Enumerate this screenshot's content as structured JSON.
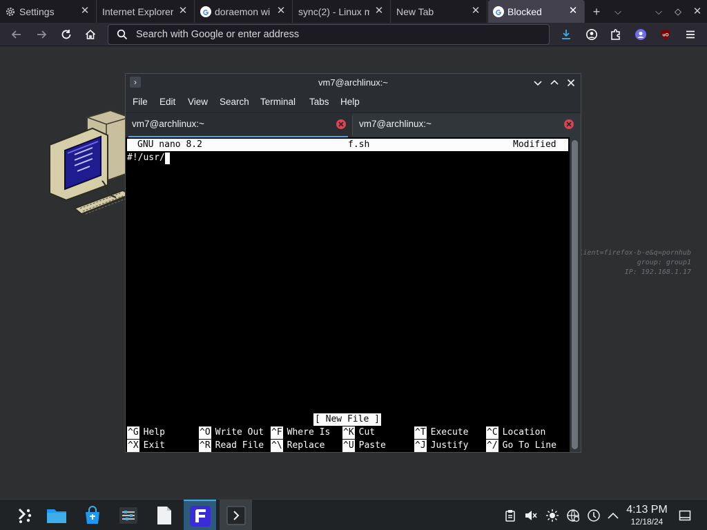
{
  "browser": {
    "tabs": [
      {
        "title": "Settings",
        "icon": "gear-icon",
        "active": false
      },
      {
        "title": "Internet Explorer",
        "icon": "",
        "active": false
      },
      {
        "title": "doraemon wi",
        "icon": "google-icon",
        "active": false
      },
      {
        "title": "sync(2) - Linux m",
        "icon": "",
        "active": false
      },
      {
        "title": "New Tab",
        "icon": "",
        "active": false
      },
      {
        "title": "Blocked",
        "icon": "google-icon",
        "active": true
      }
    ],
    "url_placeholder": "Search with Google or enter address"
  },
  "desktop": {
    "info_lines": [
      "lient=firefox-b-e&q=pornhub",
      "group: group1",
      "IP: 192.168.1.17"
    ]
  },
  "konsole": {
    "title": "vm7@archlinux:~",
    "menu": [
      "File",
      "Edit",
      "View",
      "Search",
      "Terminal",
      "Tabs",
      "Help"
    ],
    "tabs": [
      {
        "label": "vm7@archlinux:~",
        "active": true
      },
      {
        "label": "vm7@archlinux:~",
        "active": false
      }
    ],
    "nano": {
      "version": "GNU nano 8.2",
      "filename": "f.sh",
      "state": "Modified",
      "content": "#!/usr/",
      "status": "[ New File ]",
      "shortcuts_row1": [
        {
          "key": "^G",
          "label": "Help"
        },
        {
          "key": "^O",
          "label": "Write Out"
        },
        {
          "key": "^F",
          "label": "Where Is"
        },
        {
          "key": "^K",
          "label": "Cut"
        },
        {
          "key": "^T",
          "label": "Execute"
        },
        {
          "key": "^C",
          "label": "Location"
        }
      ],
      "shortcuts_row2": [
        {
          "key": "^X",
          "label": "Exit"
        },
        {
          "key": "^R",
          "label": "Read File"
        },
        {
          "key": "^\\",
          "label": "Replace"
        },
        {
          "key": "^U",
          "label": "Paste"
        },
        {
          "key": "^J",
          "label": "Justify"
        },
        {
          "key": "^/",
          "label": "Go To Line"
        }
      ]
    }
  },
  "taskbar": {
    "time": "4:13 PM",
    "date": "12/18/24"
  },
  "colors": {
    "accent": "#3daee9",
    "close_red": "#da4453",
    "terminal_bg": "#000000"
  }
}
